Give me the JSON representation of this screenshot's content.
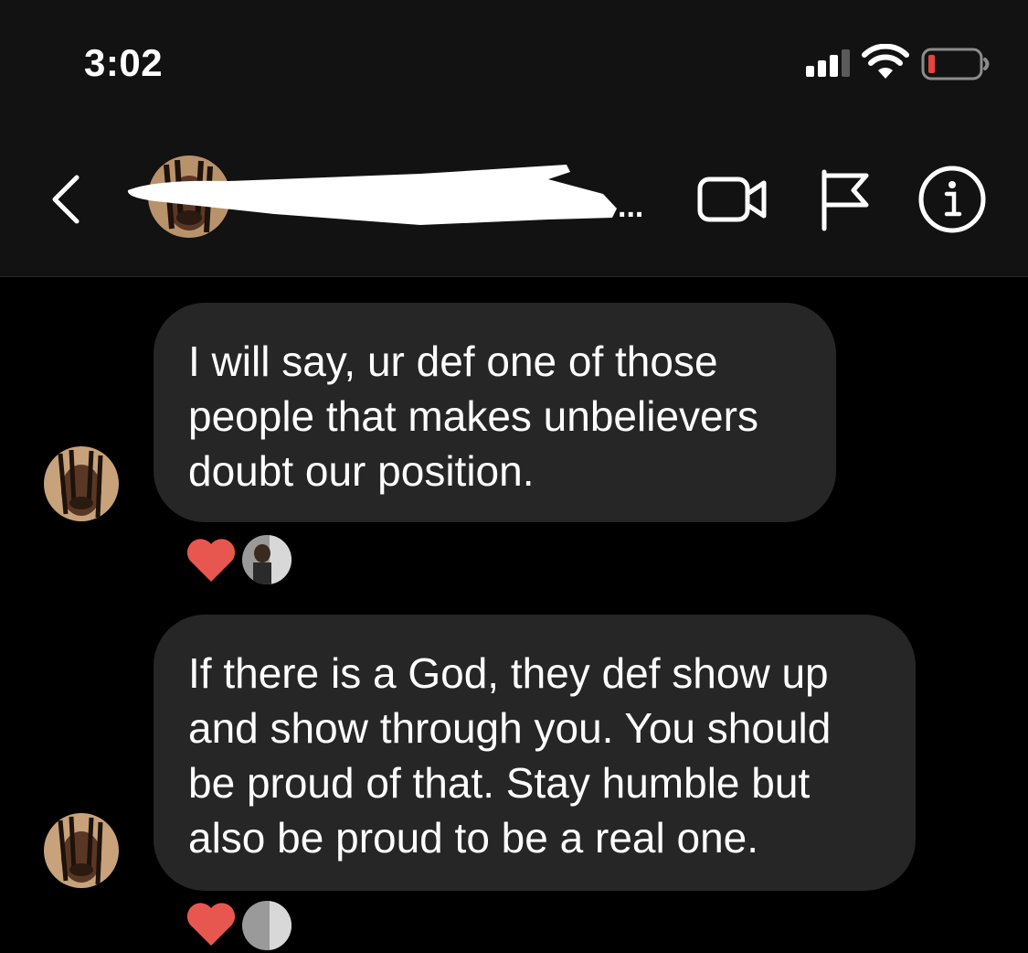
{
  "status_bar": {
    "time": "3:02",
    "signal_icon": "cellular-signal-icon",
    "wifi_icon": "wifi-icon",
    "battery_icon": "battery-low-icon",
    "battery_color": "#e5453a"
  },
  "header": {
    "back_icon": "chevron-left-icon",
    "contact_name_truncation": "...",
    "actions": [
      {
        "name": "video-call",
        "icon": "video-camera-icon"
      },
      {
        "name": "report",
        "icon": "flag-icon"
      },
      {
        "name": "info",
        "icon": "info-icon"
      }
    ]
  },
  "messages": [
    {
      "sender": "contact",
      "text": "I will say, ur def one of those people that makes unbelievers doubt our position.",
      "reaction": {
        "emoji": "heart",
        "color": "#e8574f"
      }
    },
    {
      "sender": "contact",
      "text": "If there is a God, they def show up and show through you. You should be proud of that. Stay humble but also be proud to be a real one.",
      "reaction": {
        "emoji": "heart",
        "color": "#e8574f"
      }
    }
  ],
  "colors": {
    "background": "#000000",
    "header_background": "#121212",
    "bubble": "#262626",
    "text": "#ffffff"
  }
}
